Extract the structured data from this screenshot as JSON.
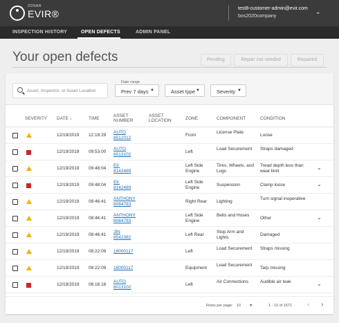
{
  "header": {
    "brand_small": "ZONAR",
    "brand": "EVIR®",
    "user_email": "test8-customer-admin@evir.com",
    "user_company": "bos2020company"
  },
  "nav": [
    "INSPECTION HISTORY",
    "OPEN DEFECTS",
    "ADMIN PANEL"
  ],
  "page": {
    "title": "Your open defects",
    "buttons": [
      "Pending",
      "Repair not needed",
      "Repaired"
    ]
  },
  "filters": {
    "search_placeholder": "Asset, Inspector, or Asset Location",
    "date_range_label": "Date range",
    "date_range_value": "Prev 7 days",
    "asset_type": "Asset type",
    "severity": "Severity"
  },
  "table": {
    "headers": [
      "SEVERITY",
      "DATE",
      "TIME",
      "ASSET NUMBER",
      "ASSET LOCATION",
      "ZONE",
      "COMPONENT",
      "CONDITION"
    ],
    "rows": [
      {
        "severity": "minor",
        "date": "12/19/2019",
        "time": "12:19:29",
        "asset": "AUTO 8512012",
        "location": "",
        "zone": "Front",
        "component": "License Plate",
        "condition": "Loose",
        "expand": false
      },
      {
        "severity": "major",
        "date": "12/19/2019",
        "time": "09:53:00",
        "asset": "AUTO 8013102",
        "location": "",
        "zone": "Left",
        "component": "Load Securement",
        "condition": "Straps damaged",
        "expand": false
      },
      {
        "severity": "minor",
        "date": "12/19/2019",
        "time": "09:48:04",
        "asset": "Eli: 8142489",
        "location": "",
        "zone": "Left Side Engine",
        "component": "Tires, Wheels, and Lugs",
        "condition": "Tread depth less than wear limit",
        "expand": true
      },
      {
        "severity": "major",
        "date": "12/19/2019",
        "time": "09:48:04",
        "asset": "Eli: 8142489",
        "location": "",
        "zone": "Left Side Engine",
        "component": "Suspension",
        "condition": "Clamp loose",
        "expand": true
      },
      {
        "severity": "minor",
        "date": "12/19/2019",
        "time": "08:46:41",
        "asset": "ANTHONY 8084783",
        "location": "",
        "zone": "Right Rear",
        "component": "Lighting",
        "condition": "Turn signal inoperative",
        "expand": false
      },
      {
        "severity": "minor",
        "date": "12/19/2019",
        "time": "08:46:41",
        "asset": "ANTHONY 8084783",
        "location": "",
        "zone": "Left Side Engine",
        "component": "Belts and Hoses",
        "condition": "Other",
        "expand": true
      },
      {
        "severity": "minor",
        "date": "12/19/2019",
        "time": "08:46:41",
        "asset": "JIN 8542382",
        "location": "",
        "zone": "Left Rear",
        "component": "Stop Arm and Lights",
        "condition": "Damaged",
        "expand": false
      },
      {
        "severity": "minor",
        "date": "12/19/2019",
        "time": "08:22:09",
        "asset": "18000117",
        "location": "",
        "zone": "Left",
        "component": "Load Securement",
        "condition": "Straps missing",
        "expand": false
      },
      {
        "severity": "minor",
        "date": "12/19/2019",
        "time": "08:22:09",
        "asset": "18000117",
        "location": "",
        "zone": "Equipment",
        "component": "Load Securement",
        "condition": "Tarp missing",
        "expand": false
      },
      {
        "severity": "major",
        "date": "12/19/2019",
        "time": "08:16:16",
        "asset": "AUTO 8013102",
        "location": "",
        "zone": "Left",
        "component": "Air Connections",
        "condition": "Audible air leak",
        "expand": true
      }
    ]
  },
  "footer": {
    "rows_per_page_label": "Rows per page:",
    "rows_per_page": "10",
    "range": "1 - 10 of 1671"
  },
  "colors": {
    "minor": "#f2b400",
    "major": "#c62828",
    "link": "#1a6fb5"
  }
}
